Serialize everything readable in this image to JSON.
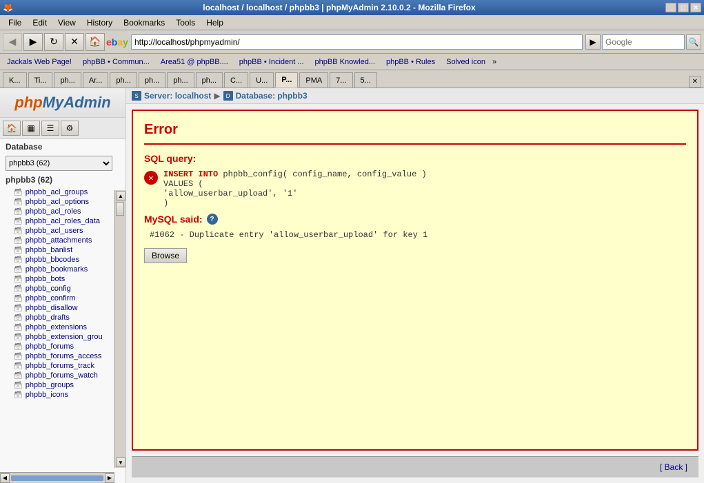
{
  "window": {
    "title": "localhost / localhost / phpbb3 | phpMyAdmin 2.10.0.2 - Mozilla Firefox",
    "os_icon": "🦊"
  },
  "menu": {
    "items": [
      "File",
      "Edit",
      "View",
      "History",
      "Bookmarks",
      "Tools",
      "Help"
    ]
  },
  "nav": {
    "url": "http://localhost/phpmyadmin/",
    "search_placeholder": "Google",
    "back_disabled": true,
    "forward_disabled": true
  },
  "bookmarks": {
    "items": [
      "Jackals Web Page!",
      "phpBB • Commun...",
      "Area51 @ phpBB....",
      "phpBB • Incident ...",
      "phpBB Knowled...",
      "phpBB • Rules",
      "Solved icon"
    ]
  },
  "tabs": {
    "items": [
      "K...",
      "Ti...",
      "ph...",
      "Ar...",
      "ph...",
      "ph...",
      "ph...",
      "ph...",
      "C...",
      "U...",
      "P...",
      "PMA",
      "7...",
      "5..."
    ]
  },
  "sidebar": {
    "logo_text": "phpMyAdmin",
    "db_label": "Database",
    "db_current": "phpbb3 (62)",
    "db_select_value": "phpbb3 (62)",
    "tables": [
      "phpbb_acl_groups",
      "phpbb_acl_options",
      "phpbb_acl_roles",
      "phpbb_acl_roles_data",
      "phpbb_acl_users",
      "phpbb_attachments",
      "phpbb_banlist",
      "phpbb_bbcodes",
      "phpbb_bookmarks",
      "phpbb_bots",
      "phpbb_config",
      "phpbb_confirm",
      "phpbb_disallow",
      "phpbb_drafts",
      "phpbb_extensions",
      "phpbb_extension_grou",
      "phpbb_forums",
      "phpbb_forums_access",
      "phpbb_forums_track",
      "phpbb_forums_watch",
      "phpbb_groups",
      "phpbb_icons"
    ]
  },
  "breadcrumb": {
    "server": "Server: localhost",
    "database": "Database: phpbb3"
  },
  "error": {
    "title": "Error",
    "sql_query_label": "SQL query:",
    "sql_text_line1": "INSERT INTO phpbb_config( config_name, config_value )",
    "sql_text_line2": "VALUES (",
    "sql_text_line3": "  'allow_userbar_upload', '1'",
    "sql_text_line4": ")",
    "mysql_said_label": "MySQL said:",
    "error_message": "#1062 - Duplicate entry 'allow_userbar_upload' for key 1",
    "browse_button": "Browse"
  },
  "back_bar": {
    "back_label": "[ Back ]"
  }
}
